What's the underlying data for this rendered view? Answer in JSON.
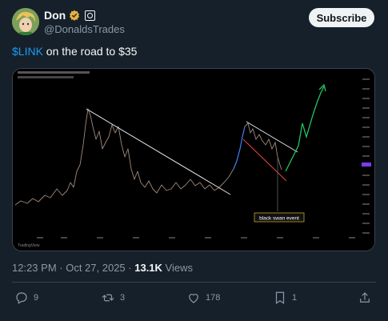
{
  "author": {
    "display_name": "Don",
    "handle": "@DonaldsTrades",
    "avatar_icon": "avatar-image",
    "verified_icon": "verified-badge-icon",
    "verified_color": "#e6b33e"
  },
  "subscribe_label": "Subscribe",
  "tweet": {
    "cashtag": "$LINK",
    "text": " on the road to $35"
  },
  "media": {
    "annotation": "black swan event",
    "brand": "TradingView"
  },
  "meta": {
    "time": "12:23 PM",
    "separator1": " · ",
    "date": "Oct 27, 2025",
    "separator2": " · ",
    "views": "13.1K",
    "views_label": " Views"
  },
  "actions": {
    "replies": "9",
    "reposts": "3",
    "likes": "178",
    "bookmarks": "1"
  },
  "colors": {
    "background": "#15202b",
    "accent": "#1d9bf0",
    "muted": "#8b98a5",
    "chart_up": "#22c55e",
    "chart_down": "#ef4444",
    "trendline": "#e5e7eb"
  }
}
